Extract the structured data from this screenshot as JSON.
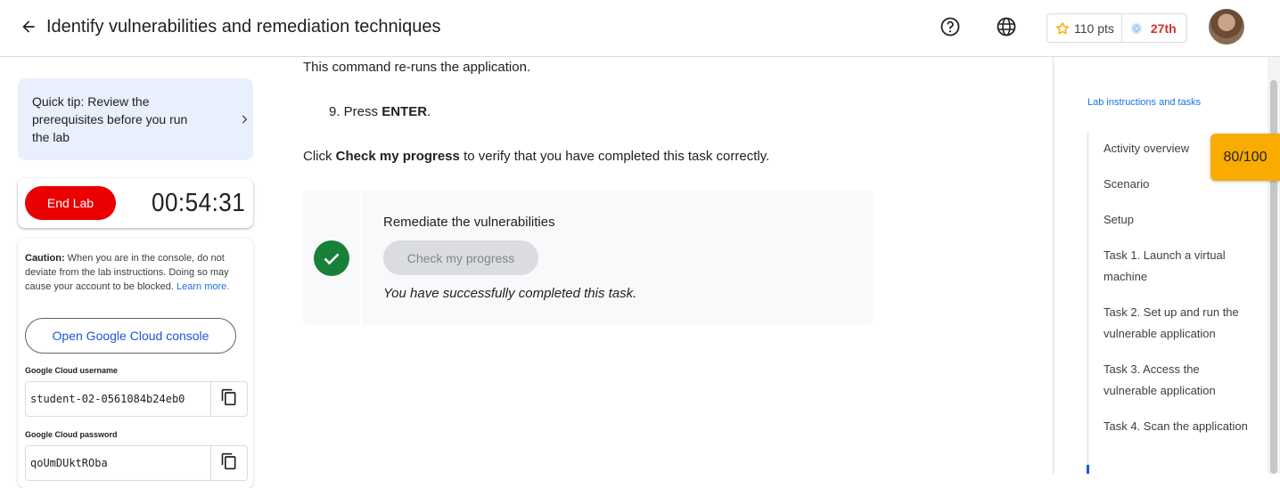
{
  "header": {
    "title": "Identify vulnerabilities and remediation techniques",
    "points": "110 pts",
    "rank": "27th"
  },
  "colors": {
    "accent_blue": "#1a73e8",
    "end_lab_red": "#ea0000",
    "success_green": "#188038",
    "score_badge": "#f9ab00",
    "rank_red": "#d93025"
  },
  "left": {
    "tip": "Quick tip: Review the prerequisites before you run the lab",
    "end_lab_label": "End Lab",
    "timer": "00:54:31",
    "caution_title": "Caution:",
    "caution_text": " When you are in the console, do not deviate from the lab instructions. Doing so may cause your account to be blocked. ",
    "learn_more": "Learn more.",
    "console_button": "Open Google Cloud console",
    "username_label": "Google Cloud username",
    "username_value": "student-02-0561084b24eb0",
    "password_label": "Google Cloud password",
    "password_value": "qoUmDUktROba"
  },
  "main": {
    "rerun_text": "This command re-runs the application.",
    "step_number": "9. Press ",
    "step_key": "ENTER",
    "step_end": ".",
    "click_prefix": "Click ",
    "click_bold": "Check my progress",
    "click_suffix": " to verify that you have completed this task correctly.",
    "check_title": "Remediate the vulnerabilities",
    "check_button": "Check my progress",
    "check_message": "You have successfully completed this task."
  },
  "toc": {
    "heading": "Lab instructions and tasks",
    "items": [
      "Activity overview",
      "Scenario",
      "Setup",
      "Task 1. Launch a virtual machine",
      "Task 2. Set up and run the vulnerable application",
      "Task 3. Access the vulnerable application",
      "Task 4. Scan the application"
    ],
    "score": "80/100"
  },
  "icons": [
    "arrow-back-icon",
    "help-icon",
    "globe-icon",
    "star-icon",
    "gem-icon",
    "chevron-right-icon",
    "copy-icon",
    "checkmark-icon"
  ]
}
